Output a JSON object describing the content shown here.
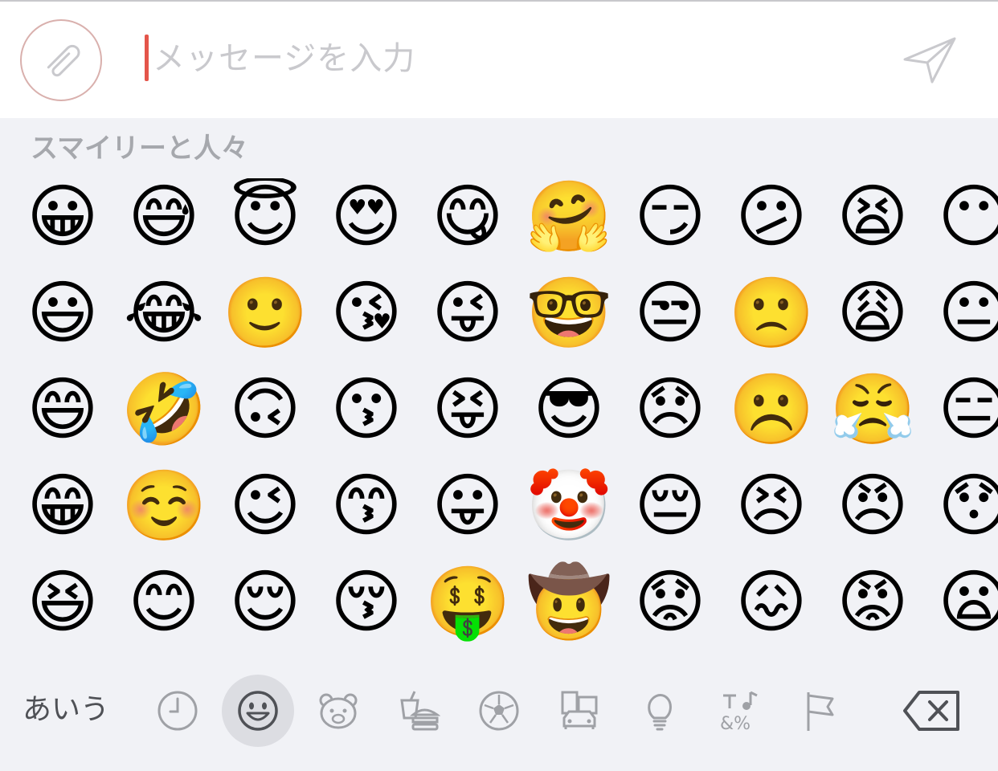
{
  "compose": {
    "placeholder": "メッセージを入力",
    "attach_icon": "paperclip-icon",
    "send_icon": "paper-plane-icon"
  },
  "emoji_panel": {
    "section_title": "スマイリーと人々",
    "rows": [
      [
        "😀",
        "😅",
        "😇",
        "😍",
        "😋",
        "🤗",
        "😏",
        "😕",
        "😫",
        "😶"
      ],
      [
        "😃",
        "😂",
        "🙂",
        "😘",
        "😜",
        "🤓",
        "😒",
        "🙁",
        "😩",
        "😐"
      ],
      [
        "😄",
        "🤣",
        "🙃",
        "😗",
        "😝",
        "😎",
        "😞",
        "☹️",
        "😤",
        "😑"
      ],
      [
        "😁",
        "☺️",
        "😉",
        "😙",
        "😛",
        "🤡",
        "😔",
        "😣",
        "😠",
        "😯"
      ],
      [
        "😆",
        "😊",
        "😌",
        "😚",
        "🤑",
        "🤠",
        "😟",
        "😖",
        "😡",
        "😦"
      ]
    ]
  },
  "keyboard_bar": {
    "language_switch": "あいう",
    "categories": [
      {
        "name": "recent",
        "icon": "clock-icon"
      },
      {
        "name": "smileys",
        "icon": "smiley-icon",
        "active": true
      },
      {
        "name": "animals",
        "icon": "bear-icon"
      },
      {
        "name": "food",
        "icon": "burger-drink-icon"
      },
      {
        "name": "activity",
        "icon": "soccer-ball-icon"
      },
      {
        "name": "travel",
        "icon": "building-car-icon"
      },
      {
        "name": "objects",
        "icon": "lightbulb-icon"
      },
      {
        "name": "symbols",
        "icon": "symbols-icon"
      },
      {
        "name": "flags",
        "icon": "flag-icon"
      }
    ],
    "delete_icon": "backspace-icon"
  },
  "colors": {
    "caret": "#e4554a",
    "panel_bg": "#f1f2f6",
    "icon_gray": "#9fa1a6"
  }
}
